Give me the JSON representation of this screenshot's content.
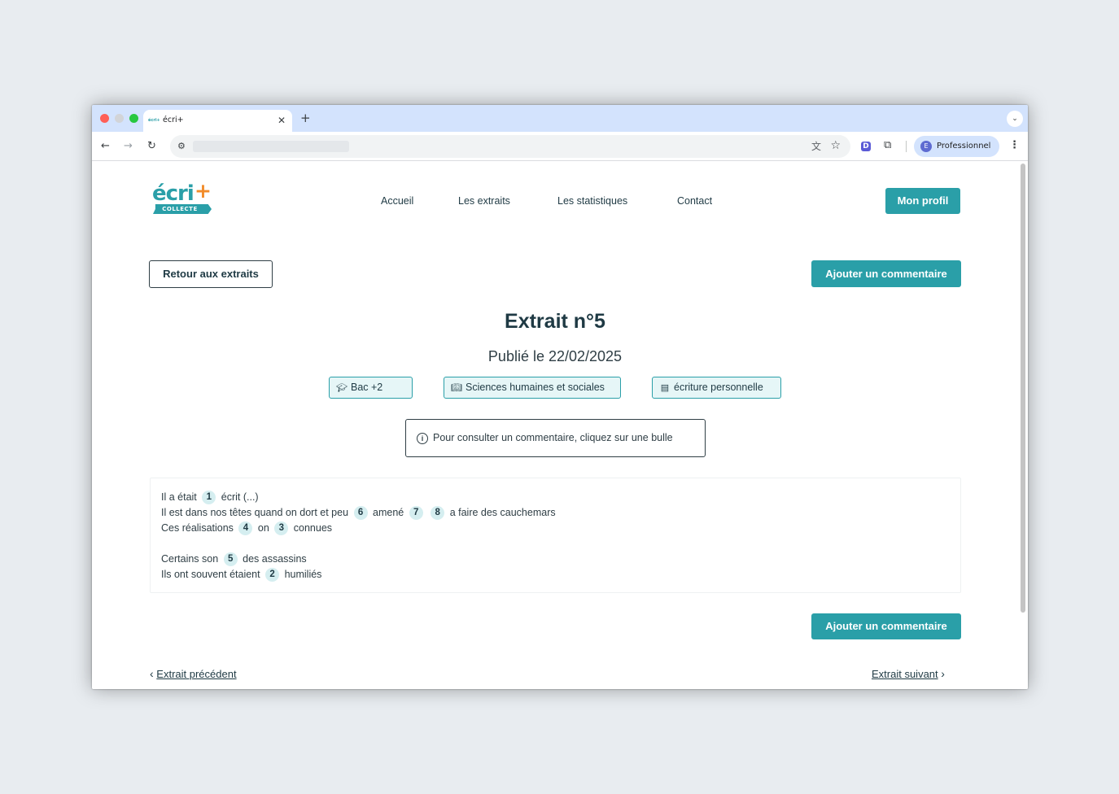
{
  "browser": {
    "tab_title": "écri+",
    "tab_favicon": "écri+",
    "profile_initial": "E",
    "profile_name": "Professionnel"
  },
  "site": {
    "logo_text": "écri",
    "logo_plus": "+",
    "logo_sub": "COLLECTE",
    "nav": [
      "Accueil",
      "Les extraits",
      "Les statistiques",
      "Contact"
    ],
    "profile_button": "Mon profil"
  },
  "page": {
    "back_button": "Retour aux extraits",
    "add_comment_button": "Ajouter un commentaire",
    "title": "Extrait n°5",
    "published": "Publié le 22/02/2025",
    "tags": {
      "level": "Bac +2",
      "domain": "Sciences humaines et sociales",
      "type": "écriture personnelle"
    },
    "info": "Pour consulter un commentaire, cliquez sur une bulle",
    "excerpt": {
      "l1a": "Il a était",
      "l1b1": "1",
      "l1c": "écrit (...)",
      "l2a": "Il est dans nos têtes quand on dort et peu",
      "l2b1": "6",
      "l2c": "amené",
      "l2b2": "7",
      "l2b3": "8",
      "l2d": "a faire des cauchemars",
      "l3a": "Ces réalisations",
      "l3b1": "4",
      "l3c": "on",
      "l3b2": "3",
      "l3d": "connues",
      "l4a": "Certains son",
      "l4b1": "5",
      "l4c": "des assassins",
      "l5a": "Ils ont souvent étaient",
      "l5b1": "2",
      "l5c": "humiliés"
    },
    "prev_link": "Extrait précédent",
    "next_link": "Extrait suivant"
  },
  "icons": {
    "level": "graduation-cap-icon",
    "domain": "book-icon",
    "type": "newspaper-icon",
    "info": "info-icon"
  },
  "colors": {
    "brand_teal": "#2a9fa8",
    "brand_orange": "#f28c2b",
    "tag_bg": "#e6f6f7",
    "bubble_bg": "#d5eef0",
    "text_dark": "#1f3a44"
  }
}
